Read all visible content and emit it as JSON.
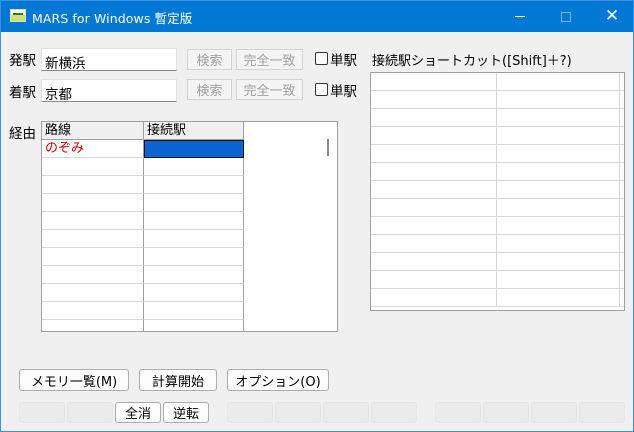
{
  "window": {
    "title": "MARS for Windows 暫定版"
  },
  "departure": {
    "label": "発駅",
    "value": "新横浜",
    "search_label": "検索",
    "exact_label": "完全一致",
    "single_label": "単駅"
  },
  "arrival": {
    "label": "着駅",
    "value": "京都",
    "search_label": "検索",
    "exact_label": "完全一致",
    "single_label": "単駅"
  },
  "route": {
    "label": "経由",
    "columns": [
      "路線",
      "接続駅"
    ],
    "rows": [
      {
        "line": "のぞみ",
        "station": ""
      }
    ]
  },
  "shortcut": {
    "title": "接続駅ショートカット([Shift]＋?)"
  },
  "buttons": {
    "memory": "メモリ一覧(M)",
    "calc": "計算開始",
    "options": "オプション(O)"
  },
  "func_buttons": {
    "all_clear": "全消",
    "reverse": "逆転"
  }
}
